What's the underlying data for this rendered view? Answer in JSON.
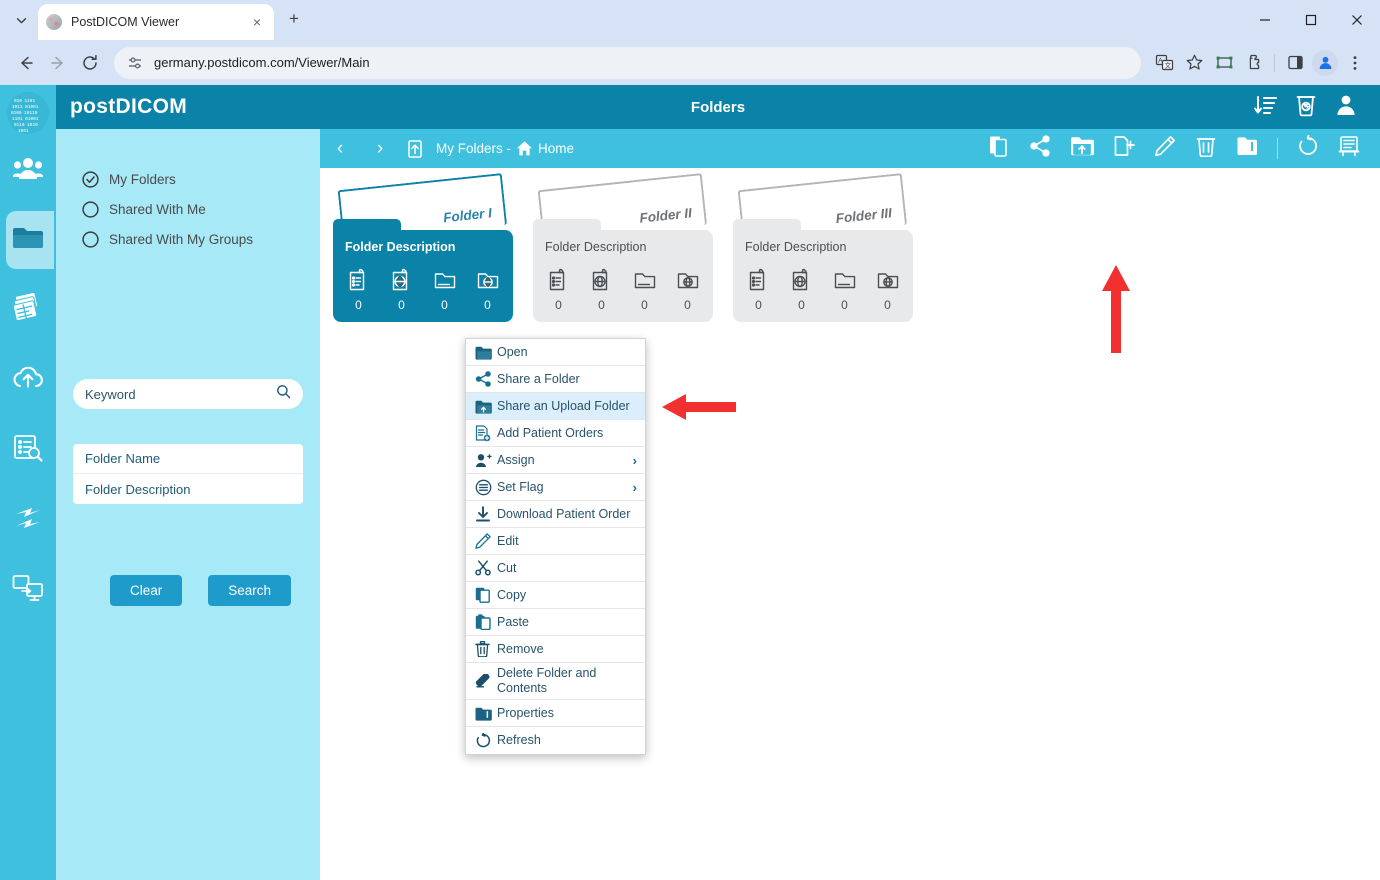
{
  "browser": {
    "tab_title": "PostDICOM Viewer",
    "tab_close": "×",
    "new_tab": "+",
    "tab_list_caret": "⌄",
    "url": "germany.postdicom.com/Viewer/Main",
    "minimize": "─",
    "maximize": "□",
    "close": "✕",
    "icons": [
      "site-settings-icon",
      "translate-icon",
      "bookmark-star-icon",
      "capture-icon",
      "extensions-icon",
      "side-panel-icon",
      "profile-icon",
      "chrome-menu-icon"
    ]
  },
  "app": {
    "brand": "postDICOM",
    "header_title": "Folders",
    "header_actions": [
      "sort-descending-icon",
      "recycle-bin-icon",
      "user-account-icon"
    ],
    "rail_items": [
      {
        "name": "logo",
        "icon": "postdicom-globe-logo",
        "active": false
      },
      {
        "name": "patients",
        "icon": "people-icon",
        "active": false
      },
      {
        "name": "folders",
        "icon": "folder-icon",
        "active": true
      },
      {
        "name": "studies",
        "icon": "images-stack-icon",
        "active": false
      },
      {
        "name": "upload",
        "icon": "cloud-upload-icon",
        "active": false
      },
      {
        "name": "reports",
        "icon": "list-search-icon",
        "active": false
      },
      {
        "name": "sync",
        "icon": "sync-arrows-icon",
        "active": false
      },
      {
        "name": "remote",
        "icon": "screens-transfer-icon",
        "active": false
      }
    ]
  },
  "left_panel": {
    "radios": [
      {
        "label": "My Folders",
        "selected": true
      },
      {
        "label": "Shared With Me",
        "selected": false
      },
      {
        "label": "Shared With My Groups",
        "selected": false
      }
    ],
    "keyword_placeholder": "Keyword",
    "keyword_value": "",
    "fields": [
      "Folder Name",
      "Folder Description"
    ],
    "clear_label": "Clear",
    "search_label": "Search"
  },
  "content_bar": {
    "back": "‹",
    "forward": "›",
    "up_icon": "up-level-icon",
    "breadcrumb_root": "My Folders -",
    "breadcrumb_home": "Home",
    "actions": [
      "copy-icon",
      "share-icon",
      "share-upload-folder-icon",
      "new-folder-icon",
      "edit-icon",
      "delete-icon",
      "properties-icon",
      "refresh-icon",
      "report-icon"
    ]
  },
  "folders": [
    {
      "title": "Folder I",
      "description": "Folder Description",
      "selected": true,
      "counts": [
        {
          "icon": "clipboard-list-icon",
          "value": "0"
        },
        {
          "icon": "clipboard-globe-icon",
          "value": "0"
        },
        {
          "icon": "folder-open-icon",
          "value": "0"
        },
        {
          "icon": "folder-globe-icon",
          "value": "0"
        }
      ]
    },
    {
      "title": "Folder II",
      "description": "Folder Description",
      "selected": false,
      "counts": [
        {
          "icon": "clipboard-list-icon",
          "value": "0"
        },
        {
          "icon": "clipboard-globe-icon",
          "value": "0"
        },
        {
          "icon": "folder-open-icon",
          "value": "0"
        },
        {
          "icon": "folder-globe-icon",
          "value": "0"
        }
      ]
    },
    {
      "title": "Folder III",
      "description": "Folder Description",
      "selected": false,
      "counts": [
        {
          "icon": "clipboard-list-icon",
          "value": "0"
        },
        {
          "icon": "clipboard-globe-icon",
          "value": "0"
        },
        {
          "icon": "folder-open-icon",
          "value": "0"
        },
        {
          "icon": "folder-globe-icon",
          "value": "0"
        }
      ]
    }
  ],
  "context_menu": {
    "items": [
      {
        "label": "Open",
        "icon": "folder-open-icon",
        "highlighted": false,
        "submenu": false
      },
      {
        "label": "Share a Folder",
        "icon": "share-icon",
        "highlighted": false,
        "submenu": false
      },
      {
        "label": "Share an Upload Folder",
        "icon": "share-upload-folder-icon",
        "highlighted": true,
        "submenu": false
      },
      {
        "label": "Add Patient Orders",
        "icon": "add-document-icon",
        "highlighted": false,
        "submenu": false
      },
      {
        "label": "Assign",
        "icon": "assign-user-icon",
        "highlighted": false,
        "submenu": true
      },
      {
        "label": "Set Flag",
        "icon": "flag-list-icon",
        "highlighted": false,
        "submenu": true
      },
      {
        "label": "Download Patient Order",
        "icon": "download-icon",
        "highlighted": false,
        "submenu": false
      },
      {
        "label": "Edit",
        "icon": "pencil-icon",
        "highlighted": false,
        "submenu": false
      },
      {
        "label": "Cut",
        "icon": "scissors-icon",
        "highlighted": false,
        "submenu": false
      },
      {
        "label": "Copy",
        "icon": "copy-icon",
        "highlighted": false,
        "submenu": false
      },
      {
        "label": "Paste",
        "icon": "paste-icon",
        "highlighted": false,
        "submenu": false
      },
      {
        "label": "Remove",
        "icon": "trash-icon",
        "highlighted": false,
        "submenu": false
      },
      {
        "label": "Delete Folder and Contents",
        "icon": "eraser-icon",
        "highlighted": false,
        "submenu": false
      },
      {
        "label": "Properties",
        "icon": "properties-folder-icon",
        "highlighted": false,
        "submenu": false
      },
      {
        "label": "Refresh",
        "icon": "refresh-icon",
        "highlighted": false,
        "submenu": false
      }
    ],
    "submenu_arrow": "›"
  },
  "annotations": [
    {
      "name": "arrow-up-to-upload-toolbar-icon",
      "direction": "up",
      "color": "#f23030"
    },
    {
      "name": "arrow-left-to-share-upload-menu-item",
      "direction": "left",
      "color": "#f23030"
    }
  ],
  "colors": {
    "teal_dark": "#0b82a8",
    "teal_light": "#3ec0de",
    "panel_blue": "#a8e9f7",
    "button_blue": "#1f9bcb",
    "menu_text": "#28536b",
    "highlight": "#dbeefb",
    "arrow_red": "#f23030"
  }
}
